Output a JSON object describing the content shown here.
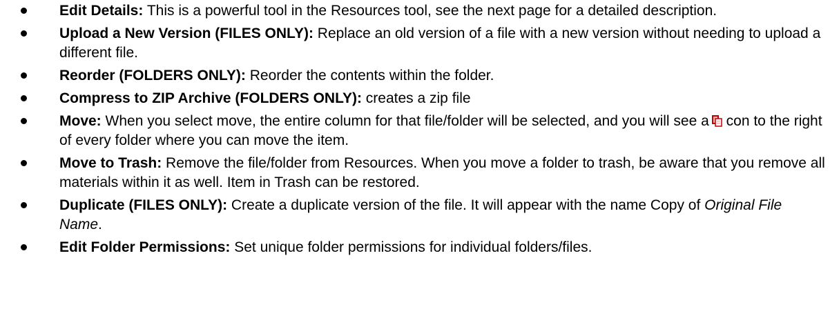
{
  "items": [
    {
      "term": "Edit Details:",
      "text": "  This is a powerful tool in the Resources tool, see the next page for a detailed description."
    },
    {
      "term": "Upload a New Version (FILES ONLY):",
      "text": "  Replace an old version of a file with a new version without needing to upload a different file."
    },
    {
      "term": "Reorder (FOLDERS ONLY):",
      "text": "  Reorder the contents within the folder."
    },
    {
      "term": "Compress to ZIP Archive (FOLDERS ONLY):",
      "text": " creates a zip file"
    },
    {
      "term": "Move:",
      "text_before_icon": " When you select move, the entire column for that file/folder will be selected, and you will see a",
      "icon": "paste-icon",
      "text_after_icon": " con to the right of every folder where you can move the item."
    },
    {
      "term": "Move to Trash:",
      "text": " Remove the file/folder from Resources.  When you move a folder to trash, be aware that you remove all materials within it as well. Item in Trash can be restored."
    },
    {
      "term": "Duplicate (FILES ONLY):",
      "text_before_italic": " Create a duplicate version of the file.  It will appear with the name Copy of ",
      "italic": "Original File Name",
      "text_after_italic": "."
    },
    {
      "term": "Edit Folder Permissions:",
      "text": "  Set unique folder permissions for individual folders/files."
    }
  ],
  "colors": {
    "text": "#000000",
    "icon_red": "#c00000",
    "icon_pink": "#f4b6b6"
  }
}
